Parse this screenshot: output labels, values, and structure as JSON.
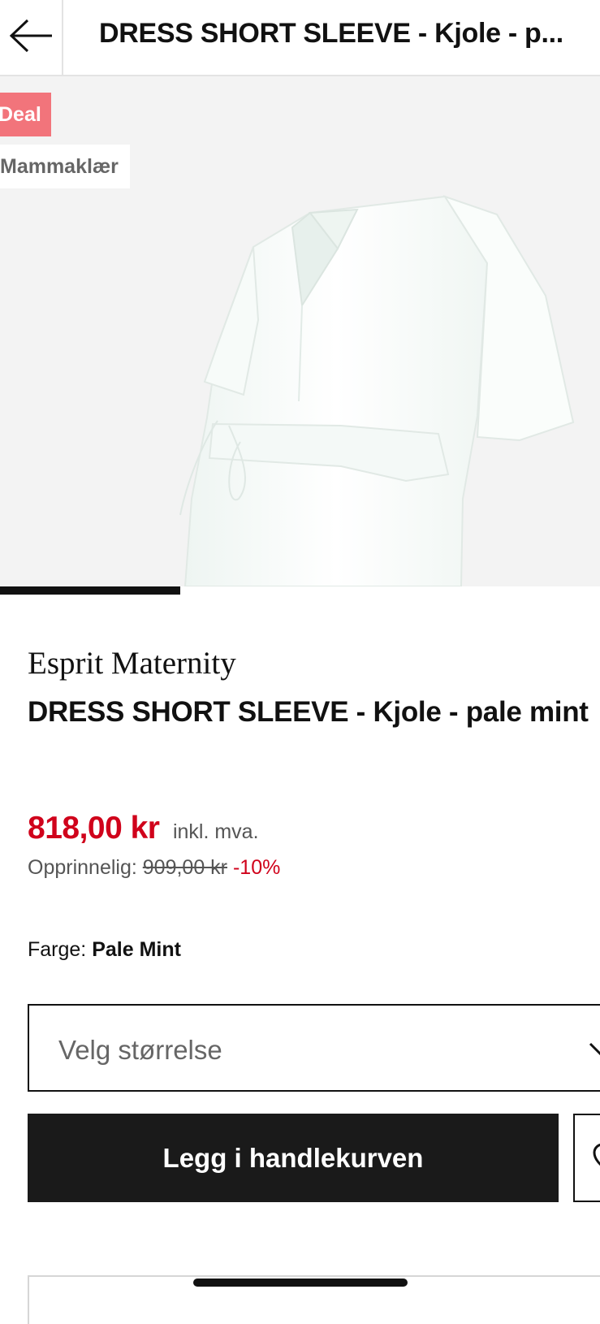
{
  "header": {
    "title": "DRESS SHORT SLEEVE - Kjole - p..."
  },
  "gallery": {
    "badges": {
      "deal": "Deal",
      "category": "Mammaklær"
    },
    "image_alt": "white short sleeve maternity dress",
    "progress": 0.3
  },
  "product": {
    "brand": "Esprit Maternity",
    "name": "DRESS SHORT SLEEVE - Kjole - pale mint",
    "price": "818,00 kr",
    "vat_note": "inkl. mva.",
    "original_label": "Opprinnelig:",
    "original_price": "909,00 kr",
    "discount": "-10%",
    "color_label": "Farge:",
    "color_value": "Pale Mint"
  },
  "size_select": {
    "placeholder": "Velg størrelse"
  },
  "actions": {
    "add_to_cart": "Legg i handlekurven"
  },
  "colors": {
    "accent": "#d0021b",
    "badge": "#f2747b",
    "button": "#1a1a1a"
  },
  "icons": {
    "back": "arrow-left-icon",
    "dropdown": "chevron-down-icon",
    "wishlist": "heart-icon"
  }
}
